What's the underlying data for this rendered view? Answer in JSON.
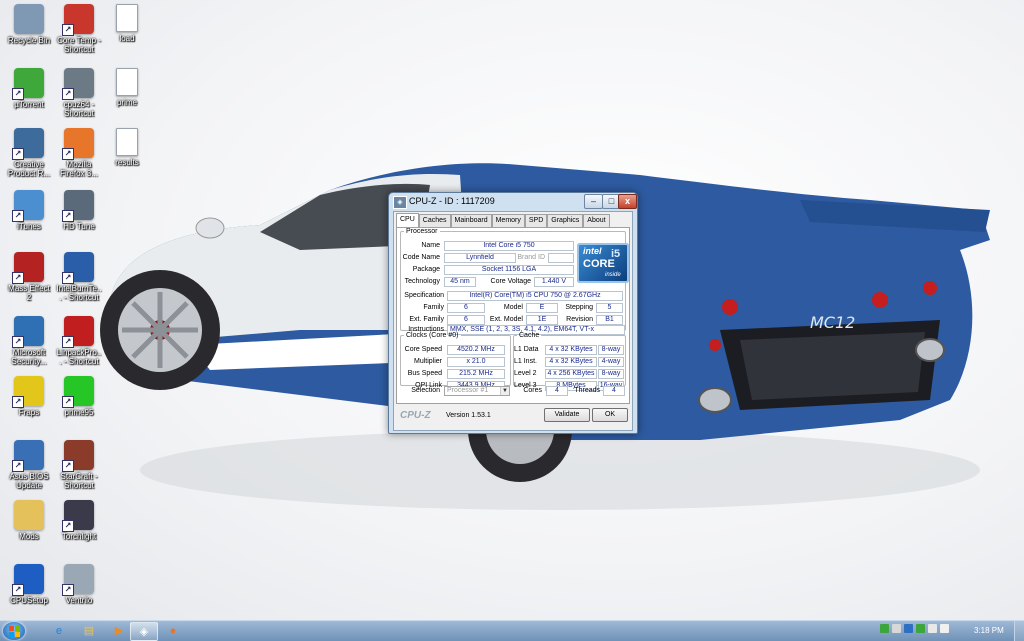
{
  "desktop": {
    "icons": [
      {
        "label": "Recycle Bin",
        "icon": "recycle-bin-icon",
        "color": "#7f99b5"
      },
      {
        "label": "Core Temp - Shortcut",
        "icon": "thermometer-icon",
        "color": "#c9372c"
      },
      {
        "label": "load",
        "icon": "document-icon",
        "color": "#ffffff"
      },
      {
        "label": "µTorrent",
        "icon": "utorrent-icon",
        "color": "#3ea83b"
      },
      {
        "label": "cpuz64 - Shortcut",
        "icon": "cpu-chip-icon",
        "color": "#6c7a86"
      },
      {
        "label": "prime",
        "icon": "document-icon",
        "color": "#ffffff"
      },
      {
        "label": "Creative Product R...",
        "icon": "creative-icon",
        "color": "#3d6c9c"
      },
      {
        "label": "Mozilla Firefox 3...",
        "icon": "firefox-icon",
        "color": "#e7762b"
      },
      {
        "label": "results",
        "icon": "document-icon",
        "color": "#ffffff"
      },
      {
        "label": "iTunes",
        "icon": "itunes-icon",
        "color": "#4b8fd1"
      },
      {
        "label": "HD Tune",
        "icon": "hd-tune-icon",
        "color": "#5a6a7a"
      },
      {
        "label": "Mass Effect 2",
        "icon": "mass-effect-icon",
        "color": "#b42222"
      },
      {
        "label": "IntelBurnTe... - Shortcut",
        "icon": "intel-burn-icon",
        "color": "#2a5ea8"
      },
      {
        "label": "Microsoft Security...",
        "icon": "security-essentials-icon",
        "color": "#2f6fb3"
      },
      {
        "label": "LinpackPro... - Shortcut",
        "icon": "linpack-icon",
        "color": "#c11f1f"
      },
      {
        "label": "Fraps",
        "icon": "fraps-icon",
        "color": "#e2c61a"
      },
      {
        "label": "prime95",
        "icon": "prime95-icon",
        "color": "#26c626"
      },
      {
        "label": "Asus BIOS Update",
        "icon": "bios-update-icon",
        "color": "#3970b5"
      },
      {
        "label": "StarCraft - Shortcut",
        "icon": "starcraft-icon",
        "color": "#8a3b2a"
      },
      {
        "label": "Mods",
        "icon": "folder-icon",
        "color": "#e4c15b"
      },
      {
        "label": "Torchlight",
        "icon": "torchlight-icon",
        "color": "#3a3a4a"
      },
      {
        "label": "CPUSetup",
        "icon": "cpusetup-icon",
        "color": "#1e5dc2"
      },
      {
        "label": "Ventrilo",
        "icon": "ventrilo-icon",
        "color": "#9aa8b6"
      }
    ]
  },
  "cpuz": {
    "title": "CPU-Z - ID : 1117209",
    "window_buttons": {
      "minimize": "–",
      "maximize": "□",
      "close": "x"
    },
    "tabs": [
      "CPU",
      "Caches",
      "Mainboard",
      "Memory",
      "SPD",
      "Graphics",
      "About"
    ],
    "processor": {
      "legend": "Processor",
      "name_label": "Name",
      "name": "Intel Core i5 750",
      "codename_label": "Code Name",
      "codename": "Lynnfield",
      "brandid_label": "Brand ID",
      "package_label": "Package",
      "package": "Socket 1156 LGA",
      "technology_label": "Technology",
      "technology": "45 nm",
      "voltage_label": "Core Voltage",
      "voltage": "1.440 V",
      "spec_label": "Specification",
      "spec": "Intel(R) Core(TM) i5 CPU        750  @ 2.67GHz",
      "family_label": "Family",
      "family": "6",
      "model_label": "Model",
      "model": "E",
      "stepping_label": "Stepping",
      "stepping": "5",
      "extfamily_label": "Ext. Family",
      "extfamily": "6",
      "extmodel_label": "Ext. Model",
      "extmodel": "1E",
      "revision_label": "Revision",
      "revision": "B1",
      "instructions_label": "Instructions",
      "instructions": "MMX, SSE (1, 2, 3, 3S, 4.1, 4.2), EM64T, VT-x",
      "logo": {
        "brand": "intel",
        "line": "CORE",
        "model": "i5",
        "tag": "inside"
      }
    },
    "clocks": {
      "legend": "Clocks (Core #0)",
      "core_speed_label": "Core Speed",
      "core_speed": "4520.2 MHz",
      "multiplier_label": "Multiplier",
      "multiplier": "x 21.0",
      "bus_speed_label": "Bus Speed",
      "bus_speed": "215.2 MHz",
      "qpi_label": "QPI Link",
      "qpi": "3443.9 MHz"
    },
    "cache": {
      "legend": "Cache",
      "rows": [
        {
          "label": "L1 Data",
          "size": "4 x 32 KBytes",
          "way": "8-way"
        },
        {
          "label": "L1 Inst.",
          "size": "4 x 32 KBytes",
          "way": "4-way"
        },
        {
          "label": "Level 2",
          "size": "4 x 256 KBytes",
          "way": "8-way"
        },
        {
          "label": "Level 3",
          "size": "8 MBytes",
          "way": "16-way"
        }
      ]
    },
    "selection": {
      "label": "Selection",
      "value": "Processor #1",
      "cores_label": "Cores",
      "cores": "4",
      "threads_label": "Threads",
      "threads": "4"
    },
    "footer": {
      "brand": "CPU-Z",
      "version": "Version 1.53.1",
      "validate": "Validate",
      "ok": "OK"
    }
  },
  "taskbar": {
    "clock": "3:18 PM",
    "pinned": [
      {
        "icon": "ie-icon",
        "glyph": "e",
        "color": "#2a7fd4"
      },
      {
        "icon": "explorer-icon",
        "glyph": "▤",
        "color": "#e8c35a"
      },
      {
        "icon": "media-player-icon",
        "glyph": "▶",
        "color": "#f08a1c"
      },
      {
        "icon": "cpuz-taskbar-icon",
        "glyph": "◈",
        "color": "#ffffff"
      },
      {
        "icon": "firefox-taskbar-icon",
        "glyph": "●",
        "color": "#e7762b"
      }
    ],
    "tray_colors": [
      "#3ca53c",
      "#d8d8d8",
      "#2e6fc1",
      "#3ca53c",
      "#e8e8e8",
      "#f0f0f0"
    ]
  }
}
